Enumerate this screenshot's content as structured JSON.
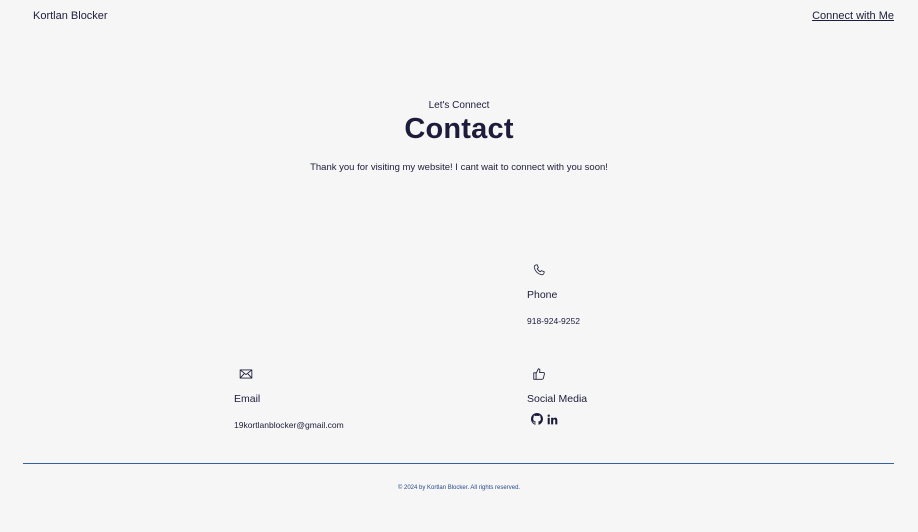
{
  "header": {
    "site_name": "Kortlan Blocker",
    "connect_link": "Connect with Me"
  },
  "hero": {
    "kicker": "Let's Connect",
    "title": "Contact",
    "tagline": "Thank you for visiting my website! I cant wait to connect with you soon!"
  },
  "contact": {
    "phone": {
      "icon": "phone-icon",
      "label": "Phone",
      "value": "918-924-9252"
    },
    "email": {
      "icon": "envelope-icon",
      "label": "Email",
      "value": "19kortlanblocker@gmail.com"
    },
    "social": {
      "icon": "thumbs-up-icon",
      "label": "Social Media",
      "links": [
        "github-icon",
        "linkedin-icon"
      ]
    }
  },
  "footer": {
    "text": "© 2024 by Kortlan Blocker. All rights reserved."
  },
  "colors": {
    "background": "#f6f6f6",
    "text": "#1d1d3b",
    "accent": "#3a5f9d"
  }
}
